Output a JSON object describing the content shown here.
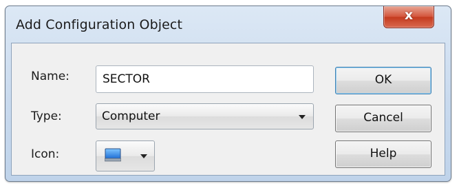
{
  "window": {
    "title": "Add Configuration Object",
    "close_glyph": "x"
  },
  "form": {
    "name_label": "Name:",
    "name_value": "SECTOR",
    "type_label": "Type:",
    "type_value": "Computer",
    "icon_label": "Icon:",
    "icon_name": "computer-monitor-icon"
  },
  "buttons": {
    "ok_label": "OK",
    "cancel_label": "Cancel",
    "help_label": "Help"
  },
  "colors": {
    "title_gradient_top": "#dce8f5",
    "close_button_red": "#c33a1e",
    "client_background": "#f0f0f0",
    "default_button_border": "#3c7fb1"
  }
}
